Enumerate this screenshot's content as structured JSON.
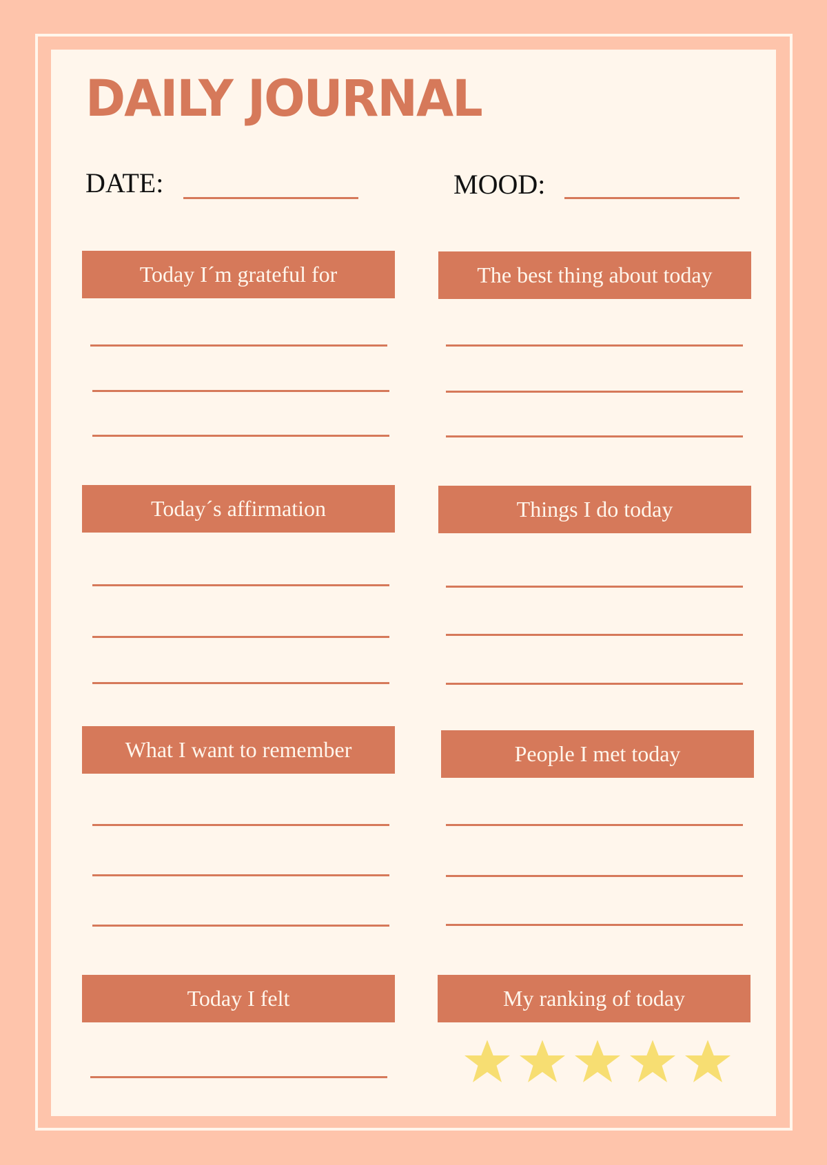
{
  "title": "DAILY JOURNAL",
  "fields": {
    "date_label": "DATE:",
    "mood_label": "MOOD:"
  },
  "sections": [
    {
      "label": "Today I´m grateful for",
      "lines": 3
    },
    {
      "label": "The best thing about today",
      "lines": 3
    },
    {
      "label": "Today´s affirmation",
      "lines": 3
    },
    {
      "label": "Things I do today",
      "lines": 3
    },
    {
      "label": "What I want to remember",
      "lines": 3
    },
    {
      "label": "People I met today",
      "lines": 3
    },
    {
      "label": "Today I felt",
      "lines": 1
    },
    {
      "label": "My ranking of today",
      "lines": 0
    }
  ],
  "ranking": {
    "stars_total": 5,
    "icon": "star-icon"
  },
  "colors": {
    "background": "#fec4ab",
    "paper": "#fff6ec",
    "accent": "#d6795a",
    "star": "#f7de72"
  }
}
